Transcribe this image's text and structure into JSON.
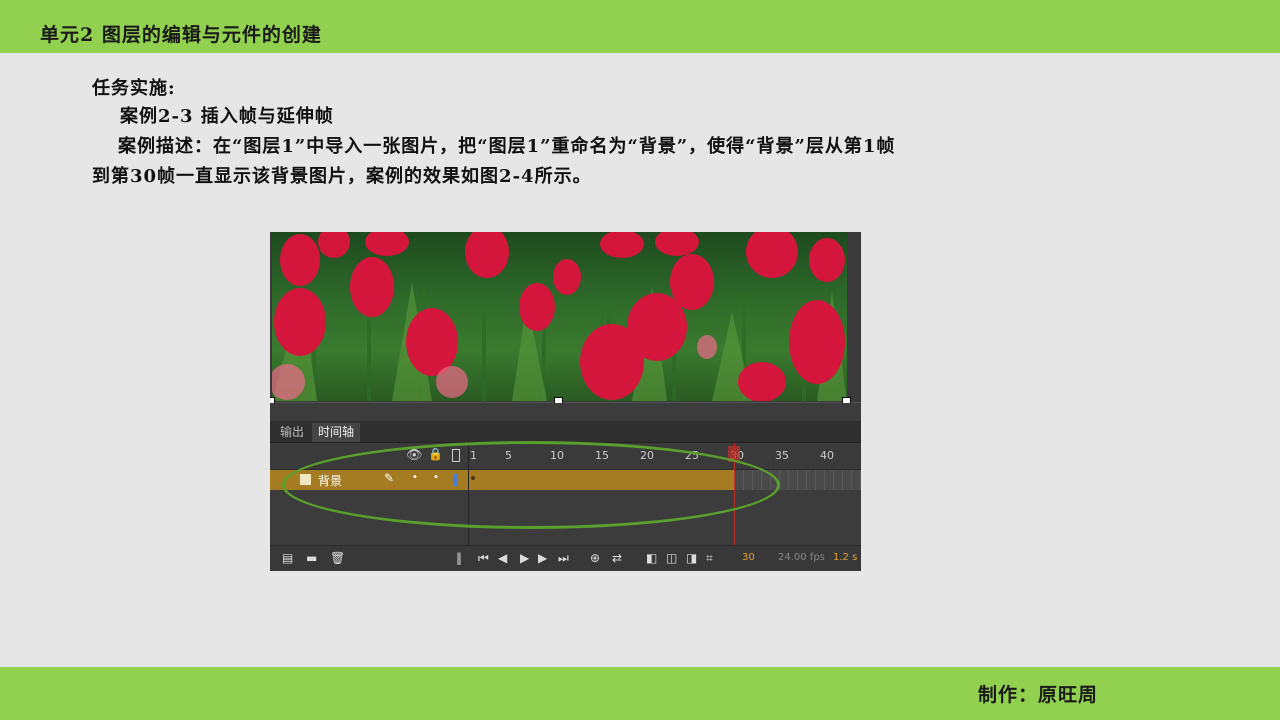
{
  "header": {
    "unit_title": "单元2 图层的编辑与元件的创建"
  },
  "content": {
    "line1": "任务实施:",
    "line2": "案例2-3   插入帧与延伸帧",
    "line3": "案例描述：在“图层1”中导入一张图片，把“图层1”重命名为“背景”，使得“背景”层从第1帧",
    "line4": "到第30帧一直显示该背景图片，案例的效果如图2-4所示。"
  },
  "app": {
    "tabs": [
      "输出",
      "时间轴"
    ],
    "frame_ruler": [
      "1",
      "5",
      "10",
      "15",
      "20",
      "25",
      "30",
      "35",
      "40"
    ],
    "layer": {
      "name": "背景"
    },
    "current_frame": "30",
    "fps": "24.00 fps",
    "elapsed": "1.2 s",
    "icons": [
      "eye-icon",
      "lock-icon",
      "outline-icon",
      "pencil-icon",
      "new-layer-icon",
      "new-folder-icon",
      "delete-icon",
      "first-frame-icon",
      "prev-frame-icon",
      "play-icon",
      "next-frame-icon",
      "last-frame-icon",
      "center-frame-icon",
      "loop-icon",
      "onion-skin-icon",
      "edit-multiple-frames-icon"
    ]
  },
  "footer": {
    "author": "制作：原旺周"
  },
  "colors": {
    "top_bar": "#92d050",
    "layer_highlight": "#a57c21",
    "oval": "#5aa02c",
    "playhead": "#c0302a"
  }
}
